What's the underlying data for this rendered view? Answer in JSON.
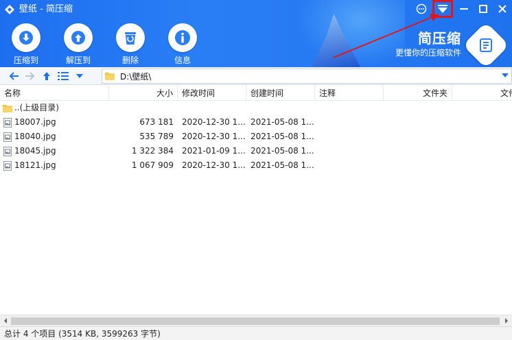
{
  "window": {
    "title": "壁纸 - 简压缩"
  },
  "toolbar": {
    "items": [
      {
        "label": "压缩到",
        "icon": "download-arrow-icon"
      },
      {
        "label": "解压到",
        "icon": "upload-arrow-icon"
      },
      {
        "label": "删除",
        "icon": "trash-icon"
      },
      {
        "label": "信息",
        "icon": "info-icon"
      }
    ]
  },
  "brand": {
    "name": "简压缩",
    "slogan": "更懂你的压缩软件"
  },
  "nav": {
    "path": "D:\\壁纸\\"
  },
  "columns": {
    "name": "名称",
    "size": "大小",
    "modified": "修改时间",
    "created": "创建时间",
    "comment": "注释",
    "folder": "文件夹",
    "file": "文件"
  },
  "files": [
    {
      "name": "..(上级目录)",
      "type": "folder",
      "size": "",
      "modified": "",
      "created": ""
    },
    {
      "name": "18007.jpg",
      "type": "image",
      "size": "673 181",
      "modified": "2020-12-30 1...",
      "created": "2021-05-08 1..."
    },
    {
      "name": "18040.jpg",
      "type": "image",
      "size": "535 789",
      "modified": "2020-12-30 1...",
      "created": "2021-05-08 1..."
    },
    {
      "name": "18045.jpg",
      "type": "image",
      "size": "1 322 384",
      "modified": "2021-01-09 1...",
      "created": "2021-05-08 1..."
    },
    {
      "name": "18121.jpg",
      "type": "image",
      "size": "1 067 909",
      "modified": "2020-12-30 1...",
      "created": "2021-05-08 1..."
    }
  ],
  "status": {
    "text": "总计 4 个项目 (3514 KB, 3599263 字节)"
  },
  "colors": {
    "header_blue": "#1f72ee",
    "highlight_red": "#e0161e"
  }
}
